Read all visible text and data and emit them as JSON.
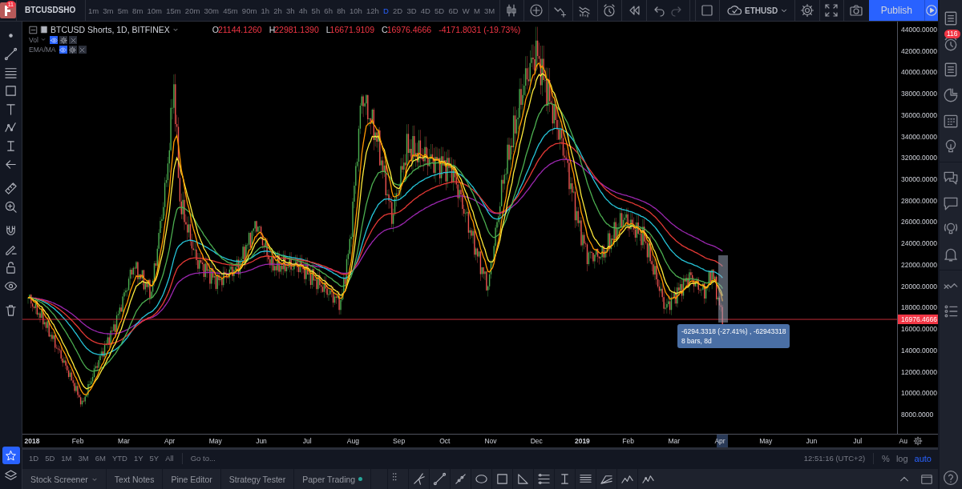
{
  "top_bar": {
    "symbol": "BTCUSDSHO",
    "notification_count": "11",
    "intervals": [
      {
        "label": "1m",
        "selected": false
      },
      {
        "label": "3m",
        "selected": false
      },
      {
        "label": "5m",
        "selected": false
      },
      {
        "label": "8m",
        "selected": false
      },
      {
        "label": "10m",
        "selected": false
      },
      {
        "label": "15m",
        "selected": false
      },
      {
        "label": "20m",
        "selected": false
      },
      {
        "label": "30m",
        "selected": false
      },
      {
        "label": "45m",
        "selected": false
      },
      {
        "label": "90m",
        "selected": false
      },
      {
        "label": "1h",
        "selected": false
      },
      {
        "label": "2h",
        "selected": false
      },
      {
        "label": "3h",
        "selected": false
      },
      {
        "label": "4h",
        "selected": false
      },
      {
        "label": "5h",
        "selected": false
      },
      {
        "label": "6h",
        "selected": false
      },
      {
        "label": "8h",
        "selected": false
      },
      {
        "label": "10h",
        "selected": false
      },
      {
        "label": "12h",
        "selected": false
      },
      {
        "label": "D",
        "selected": true
      },
      {
        "label": "2D",
        "selected": false
      },
      {
        "label": "3D",
        "selected": false
      },
      {
        "label": "4D",
        "selected": false
      },
      {
        "label": "5D",
        "selected": false
      },
      {
        "label": "6D",
        "selected": false
      },
      {
        "label": "W",
        "selected": false
      },
      {
        "label": "M",
        "selected": false
      },
      {
        "label": "3M",
        "selected": false
      }
    ],
    "compare_symbol": "ETHUSD",
    "publish": "Publish"
  },
  "legend": {
    "title": "BTCUSD Shorts, 1D, BITFINEX",
    "ohlc": [
      {
        "key": "O",
        "value": "21144.1260"
      },
      {
        "key": "H",
        "value": "22981.1390"
      },
      {
        "key": "L",
        "value": "16671.9109"
      },
      {
        "key": "C",
        "value": "16976.4666"
      }
    ],
    "change": "-4171.8031 (-19.73%)",
    "indicators": [
      {
        "name": "Vol",
        "has_menu": true
      },
      {
        "name": "EMA/MA",
        "has_menu": false
      }
    ]
  },
  "price_axis": {
    "labels": [
      "44000.0000",
      "42000.0000",
      "40000.0000",
      "38000.0000",
      "36000.0000",
      "34000.0000",
      "32000.0000",
      "30000.0000",
      "28000.0000",
      "26000.0000",
      "24000.0000",
      "22000.0000",
      "20000.0000",
      "18000.0000",
      "16000.0000",
      "14000.0000",
      "12000.0000",
      "10000.0000",
      "8000.0000"
    ],
    "last_price": "16976.4666"
  },
  "time_axis": {
    "labels": [
      {
        "label": "2018",
        "kind": "year"
      },
      {
        "label": "Feb",
        "kind": "month"
      },
      {
        "label": "Mar",
        "kind": "month"
      },
      {
        "label": "Apr",
        "kind": "month"
      },
      {
        "label": "May",
        "kind": "month"
      },
      {
        "label": "Jun",
        "kind": "month"
      },
      {
        "label": "Jul",
        "kind": "month"
      },
      {
        "label": "Aug",
        "kind": "month"
      },
      {
        "label": "Sep",
        "kind": "month"
      },
      {
        "label": "Oct",
        "kind": "month"
      },
      {
        "label": "Nov",
        "kind": "month"
      },
      {
        "label": "Dec",
        "kind": "month"
      },
      {
        "label": "2019",
        "kind": "year"
      },
      {
        "label": "Feb",
        "kind": "month"
      },
      {
        "label": "Mar",
        "kind": "month"
      },
      {
        "label": "Apr",
        "kind": "month"
      },
      {
        "label": "May",
        "kind": "month"
      },
      {
        "label": "Jun",
        "kind": "month"
      },
      {
        "label": "Jul",
        "kind": "month"
      },
      {
        "label": "Au",
        "kind": "month"
      }
    ]
  },
  "measure": {
    "readout": "-6294.3318 (-27.41%) , -62943318",
    "bars": "8 bars, 8d"
  },
  "range_bar": {
    "ranges": [
      "1D",
      "5D",
      "1M",
      "3M",
      "6M",
      "YTD",
      "1Y",
      "5Y",
      "All"
    ],
    "goto": "Go to...",
    "clock": "12:51:16 (UTC+2)",
    "scale_options": [
      {
        "label": "%",
        "selected": false
      },
      {
        "label": "log",
        "selected": false
      },
      {
        "label": "auto",
        "selected": true
      }
    ]
  },
  "bottom_tabs": [
    {
      "label": "Stock Screener",
      "has_menu": true,
      "status_dot": false
    },
    {
      "label": "Text Notes",
      "has_menu": false,
      "status_dot": false
    },
    {
      "label": "Pine Editor",
      "has_menu": false,
      "status_dot": false
    },
    {
      "label": "Strategy Tester",
      "has_menu": false,
      "status_dot": false
    },
    {
      "label": "Paper Trading",
      "has_menu": false,
      "status_dot": true
    }
  ],
  "right_sidebar": {
    "alert_count": "116"
  }
}
